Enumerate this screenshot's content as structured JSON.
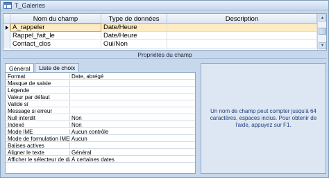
{
  "window": {
    "title": "T_Galeries"
  },
  "grid": {
    "headers": [
      "Nom du champ",
      "Type de données",
      "Description"
    ],
    "rows": [
      {
        "name": "A_rappeler",
        "type": "Date/Heure",
        "description": ""
      },
      {
        "name": "Rappel_fait_le",
        "type": "Date/Heure",
        "description": ""
      },
      {
        "name": "Contact_clos",
        "type": "Oui/Non",
        "description": ""
      }
    ]
  },
  "properties": {
    "section_label": "Propriétés du champ",
    "tabs": [
      "Général",
      "Liste de choix"
    ],
    "active_tab": "Général",
    "rows": [
      {
        "label": "Format",
        "value": "Date, abrégé"
      },
      {
        "label": "Masque de saisie",
        "value": ""
      },
      {
        "label": "Légende",
        "value": ""
      },
      {
        "label": "Valeur par défaut",
        "value": ""
      },
      {
        "label": "Valide si",
        "value": ""
      },
      {
        "label": "Message si erreur",
        "value": ""
      },
      {
        "label": "Null interdit",
        "value": "Non"
      },
      {
        "label": "Indexé",
        "value": "Non"
      },
      {
        "label": "Mode IME",
        "value": "Aucun contrôle"
      },
      {
        "label": "Mode de formulation IME",
        "value": "Aucun"
      },
      {
        "label": "Balises actives",
        "value": ""
      },
      {
        "label": "Aligner le texte",
        "value": "Général"
      },
      {
        "label": "Afficher le sélecteur de da",
        "value": "À certaines dates"
      }
    ]
  },
  "help": {
    "text": "Un nom de champ peut compter jusqu'à 64 caractères, espaces inclus. Pour obtenir de l'aide, appuyez sur F1."
  },
  "colors": {
    "selected_row": "#fdebc3",
    "selected_border": "#e8a33a",
    "frame": "#c7d8ec",
    "help_text": "#1f3c7a"
  }
}
